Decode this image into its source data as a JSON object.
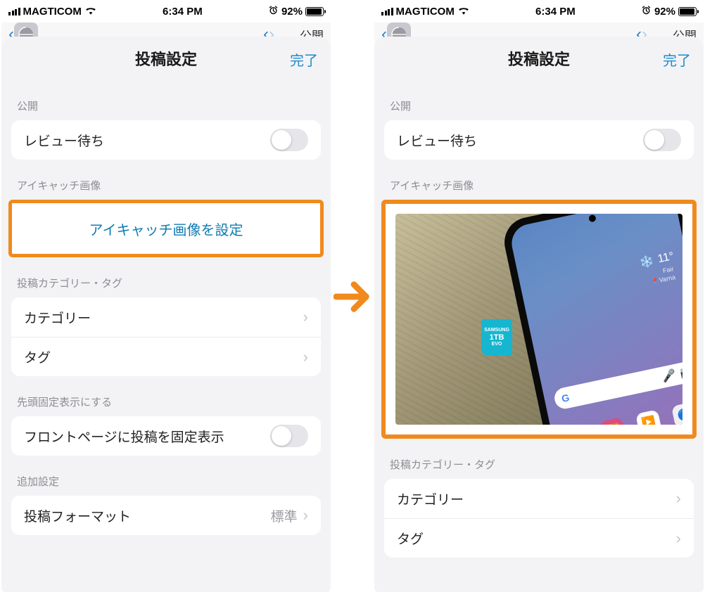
{
  "status": {
    "carrier": "MAGTICOM",
    "time": "6:34 PM",
    "battery_pct": "92%"
  },
  "bgnav": {
    "right_label": "公開"
  },
  "sheet": {
    "title": "投稿設定",
    "done": "完了"
  },
  "sections": {
    "publish_label": "公開",
    "review_wait": "レビュー待ち",
    "featured_label": "アイキャッチ画像",
    "set_featured_action": "アイキャッチ画像を設定",
    "cat_tag_label": "投稿カテゴリー・タグ",
    "category": "カテゴリー",
    "tag": "タグ",
    "sticky_label": "先頭固定表示にする",
    "sticky_row": "フロントページに投稿を固定表示",
    "extra_label": "追加設定",
    "post_format": "投稿フォーマット",
    "post_format_value": "標準"
  },
  "thumb": {
    "sd_brand": "SAMSUNG",
    "sd_cap": "1TB",
    "sd_line": "EVO",
    "temp": "11°",
    "loc1": "Fair",
    "loc2": "Varna"
  }
}
